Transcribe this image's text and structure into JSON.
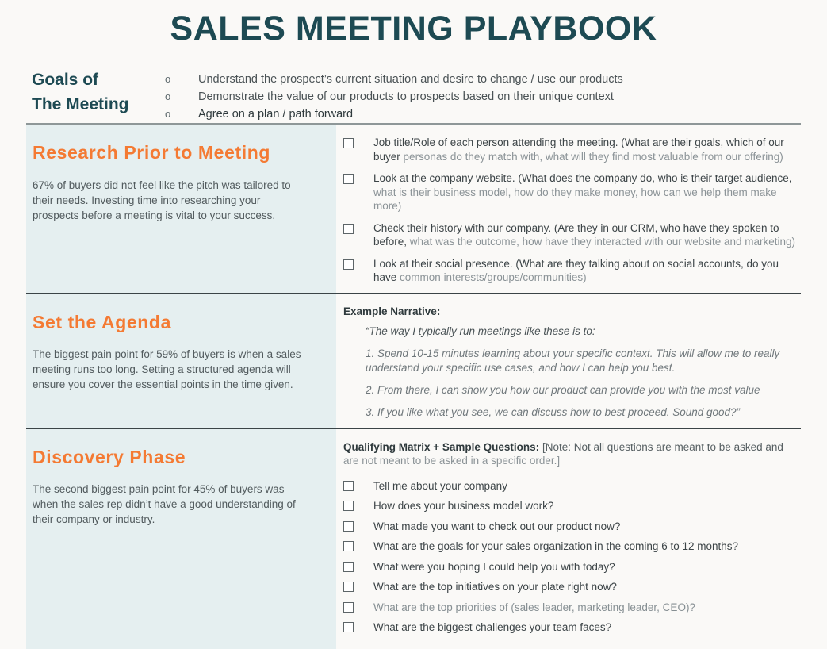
{
  "document": {
    "title": "SALES MEETING PLAYBOOK",
    "accent_orange": "#f47a33",
    "accent_teal": "#1d4a53",
    "panel_blue": "#e5eff0",
    "page_background": "#faf9f7"
  },
  "goals": {
    "label_line1": "Goals of",
    "label_line2": "The Meeting",
    "bullet_glyph": "o",
    "items": [
      "Understand the prospect’s current situation and desire to change / use our products",
      "Demonstrate the value of our products to prospects based on their unique context",
      "Agree on a plan / path forward"
    ]
  },
  "sections": [
    {
      "heading": "Research Prior to Meeting",
      "blurb": "67% of buyers did not feel like the pitch was tailored to their needs. Investing time into researching your prospects before a meeting is vital to your success.",
      "checklist": [
        {
          "lead": "Job title/Role of each person attending the meeting. (What are their goals, which of our buyer",
          "tail": "personas do they match with, what will they find most valuable from our offering)"
        },
        {
          "lead": "Look at the company website. (What does the company do, who is their target audience,",
          "tail": "what is their business model, how do they make money, how can we help them make more)"
        },
        {
          "lead": "Check their history with our company. (Are they in our CRM, who have they spoken to before,",
          "tail": "what was the outcome, how have they interacted with our website and marketing)"
        },
        {
          "lead": "Look at their social presence. (What are they talking about on social accounts, do you have",
          "tail": "common interests/groups/communities)"
        }
      ]
    },
    {
      "heading": "Set the Agenda",
      "blurb": "The biggest pain point for 59% of buyers is when a sales meeting runs too long. Setting a structured agenda will ensure you cover the essential points in the time given.",
      "narrative_title": "Example Narrative:",
      "narrative_lines": [
        "“The way I typically run meetings like these is to:",
        "1. Spend 10-15 minutes learning about your specific context.  This will allow me to really understand your specific use cases, and how I can help you best.",
        "2. From there, I can show you how our product can provide you with the most value",
        "3. If you like what you see, we can discuss how to best proceed. Sound good?”"
      ]
    },
    {
      "heading": "Discovery Phase",
      "blurb": "The second biggest pain point for 45% of buyers was when the sales rep didn’t have a good understanding of their company or industry.",
      "qualifying_label": "Qualifying Matrix + Sample Questions:",
      "qualifying_note": " [Note:  Not all questions are meant to be asked and",
      "qualifying_note2": "are not meant to be asked in a specific order.]",
      "questions": [
        "Tell me about your company",
        "How does your business model work?",
        "What made you want to check out our product now?",
        "What are the goals for your sales organization in the coming 6 to 12 months?",
        "What were you hoping I could help you with today?",
        "What are the top initiatives on your plate right now?",
        "What are the top priorities of (sales leader, marketing leader, CEO)?",
        "What are the biggest challenges your team faces?"
      ]
    }
  ]
}
